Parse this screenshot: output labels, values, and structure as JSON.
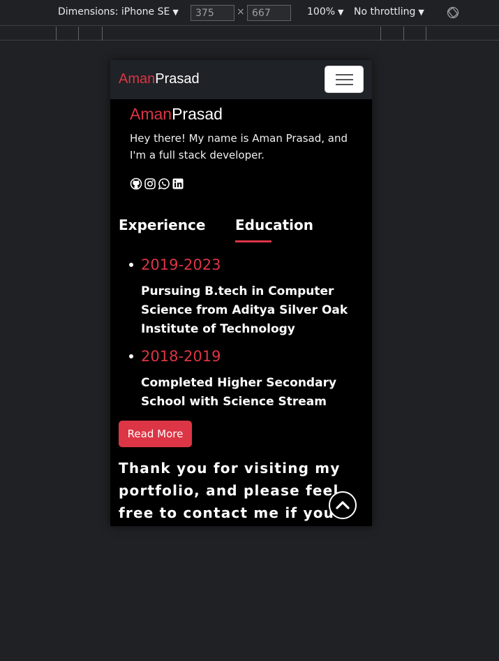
{
  "devtools": {
    "dimensions_label": "Dimensions: iPhone SE",
    "width": "375",
    "height": "667",
    "times": "×",
    "zoom": "100%",
    "throttling": "No throttling"
  },
  "navbar": {
    "brand_first": "Aman",
    "brand_last": "Prasad",
    "toggler_icon": "hamburger-icon"
  },
  "hero": {
    "name_first": "Aman",
    "name_last": "Prasad",
    "intro": "Hey there! My name is Aman Prasad, and I'm a full stack developer.",
    "social_icons": [
      "github-icon",
      "instagram-icon",
      "whatsapp-icon",
      "linkedin-icon"
    ]
  },
  "tabs": {
    "experience": "Experience",
    "education": "Education",
    "active": "education"
  },
  "education": [
    {
      "year": "2019-2023",
      "description": "Pursuing B.tech in Computer Science from Aditya Silver Oak Institute of Technology"
    },
    {
      "year": "2018-2019",
      "description": "Completed Higher Secondary School with Science Stream"
    }
  ],
  "read_more_label": "Read More",
  "thanks_text": "Thank you for visiting my portfolio, and please feel free to contact me if you have",
  "colors": {
    "accent": "#dc3545",
    "navbar_bg": "#1f2226",
    "page_bg": "#000000"
  }
}
